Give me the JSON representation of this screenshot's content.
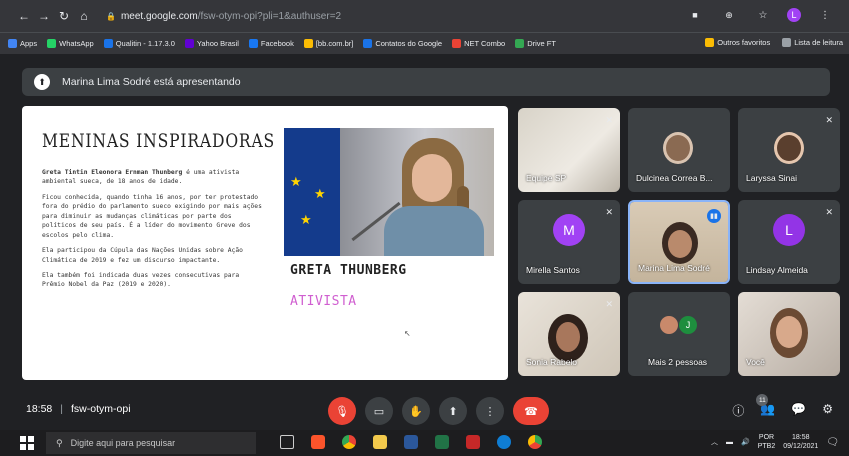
{
  "browser": {
    "url_host": "meet.google.com",
    "url_path": "/fsw-otym-opi?pli=1&authuser=2",
    "profile_initial": "L",
    "bookmarks": [
      {
        "label": "Apps",
        "color": "#4285f4"
      },
      {
        "label": "WhatsApp",
        "color": "#25d366"
      },
      {
        "label": "Qualitin - 1.17.3.0",
        "color": "#1a73e8"
      },
      {
        "label": "Yahoo Brasil",
        "color": "#6001d2"
      },
      {
        "label": "Facebook",
        "color": "#1877f2"
      },
      {
        "label": "[bb.com.br]",
        "color": "#fbbc04"
      },
      {
        "label": "Contatos do Google",
        "color": "#1a73e8"
      },
      {
        "label": "NET Combo",
        "color": "#ea4335"
      },
      {
        "label": "Drive FT",
        "color": "#34a853"
      }
    ],
    "bookmarks_right": [
      "Outros favoritos",
      "Lista de leitura"
    ]
  },
  "meet": {
    "presenting_banner": "Marina Lima Sodré está apresentando",
    "time": "18:58",
    "meeting_code": "fsw-otym-opi",
    "participant_count": "11",
    "tiles": [
      {
        "name": "Equipe SP",
        "initial": "",
        "color": ""
      },
      {
        "name": "Dulcinea Correa B...",
        "initial": "",
        "color": ""
      },
      {
        "name": "Laryssa Sinai",
        "initial": "",
        "color": ""
      },
      {
        "name": "Mirella Santos",
        "initial": "M",
        "color": "#a142f4"
      },
      {
        "name": "Marina Lima Sodré",
        "initial": "",
        "color": ""
      },
      {
        "name": "Lindsay Almeida",
        "initial": "L",
        "color": "#9334e6"
      },
      {
        "name": "Sonia Rabelo",
        "initial": "",
        "color": ""
      },
      {
        "name": "Mais 2 pessoas",
        "initial": "J",
        "color": "#1e8e3e"
      },
      {
        "name": "Você",
        "initial": "",
        "color": ""
      }
    ]
  },
  "slide": {
    "title": "MENINAS INSPIRADORAS",
    "intro_bold": "Greta Tintin Eleonora Ernman Thunberg",
    "intro_rest": " é uma ativista ambiental sueca, de 18 anos de idade.",
    "paragraphs": [
      "Ficou conhecida, quando tinha 16 anos, por ter protestado fora do prédio do parlamento sueco exigindo por mais ações para diminuir as mudanças climáticas por parte dos políticos de seu país. É a líder do movimento Greve dos escolos pelo clima.",
      "Ela participou da Cúpula das Nações Unidas sobre Ação Climática de 2019 e fez um discurso impactante.",
      "Ela também foi indicada duas vezes consecutivas para Prêmio Nobel da Paz (2019 e 2020)."
    ],
    "name_heading": "GRETA THUNBERG",
    "role_heading": "ATIVISTA"
  },
  "taskbar": {
    "search_placeholder": "Digite aqui para pesquisar",
    "lang_top": "POR",
    "lang_bottom": "PTB2",
    "clock_time": "18:58",
    "clock_date": "09/12/2021"
  }
}
